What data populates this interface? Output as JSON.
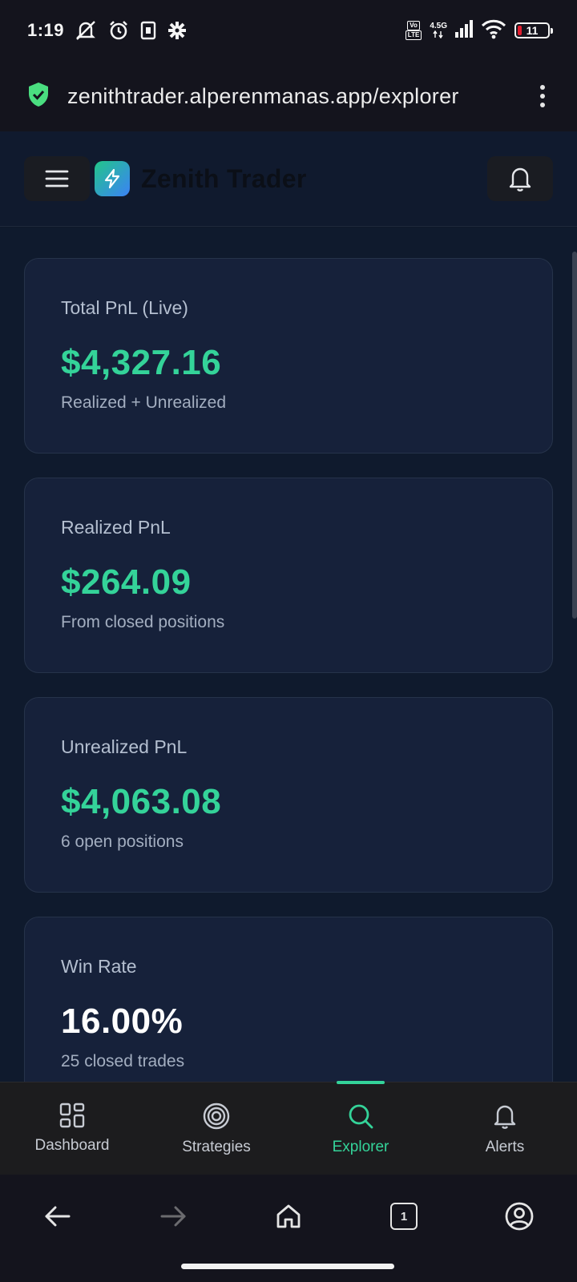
{
  "status_bar": {
    "time": "1:19",
    "network_badge_top": "Vo",
    "network_badge_bottom": "LTE",
    "network_type": "4.5G",
    "battery_level": "11"
  },
  "browser": {
    "url": "zenithtrader.alperenmanas.app/explorer",
    "secure_icon": "shield-check-icon",
    "tab_count": "1"
  },
  "app_header": {
    "title": "Zenith Trader"
  },
  "cards": [
    {
      "label": "Total PnL (Live)",
      "value": "$4,327.16",
      "sub": "Realized + Unrealized",
      "value_color": "#34d399"
    },
    {
      "label": "Realized PnL",
      "value": "$264.09",
      "sub": "From closed positions",
      "value_color": "#34d399"
    },
    {
      "label": "Unrealized PnL",
      "value": "$4,063.08",
      "sub": "6 open positions",
      "value_color": "#34d399"
    },
    {
      "label": "Win Rate",
      "value": "16.00%",
      "sub": "25 closed trades",
      "value_color": "#ffffff"
    }
  ],
  "bottom_nav": {
    "items": [
      {
        "label": "Dashboard",
        "icon": "grid-icon"
      },
      {
        "label": "Strategies",
        "icon": "target-icon"
      },
      {
        "label": "Explorer",
        "icon": "search-icon"
      },
      {
        "label": "Alerts",
        "icon": "bell-icon"
      }
    ],
    "active": "Explorer",
    "accent_color": "#34d399"
  },
  "colors": {
    "background": "#0f1a2d",
    "card": "#16213a",
    "positive": "#34d399"
  }
}
